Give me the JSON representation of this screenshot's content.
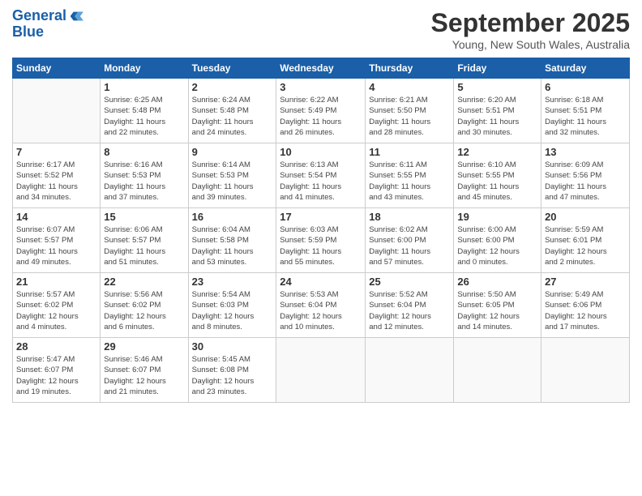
{
  "header": {
    "logo_line1": "General",
    "logo_line2": "Blue",
    "title": "September 2025",
    "subtitle": "Young, New South Wales, Australia"
  },
  "columns": [
    "Sunday",
    "Monday",
    "Tuesday",
    "Wednesday",
    "Thursday",
    "Friday",
    "Saturday"
  ],
  "weeks": [
    [
      {
        "num": "",
        "detail": ""
      },
      {
        "num": "1",
        "detail": "Sunrise: 6:25 AM\nSunset: 5:48 PM\nDaylight: 11 hours\nand 22 minutes."
      },
      {
        "num": "2",
        "detail": "Sunrise: 6:24 AM\nSunset: 5:48 PM\nDaylight: 11 hours\nand 24 minutes."
      },
      {
        "num": "3",
        "detail": "Sunrise: 6:22 AM\nSunset: 5:49 PM\nDaylight: 11 hours\nand 26 minutes."
      },
      {
        "num": "4",
        "detail": "Sunrise: 6:21 AM\nSunset: 5:50 PM\nDaylight: 11 hours\nand 28 minutes."
      },
      {
        "num": "5",
        "detail": "Sunrise: 6:20 AM\nSunset: 5:51 PM\nDaylight: 11 hours\nand 30 minutes."
      },
      {
        "num": "6",
        "detail": "Sunrise: 6:18 AM\nSunset: 5:51 PM\nDaylight: 11 hours\nand 32 minutes."
      }
    ],
    [
      {
        "num": "7",
        "detail": "Sunrise: 6:17 AM\nSunset: 5:52 PM\nDaylight: 11 hours\nand 34 minutes."
      },
      {
        "num": "8",
        "detail": "Sunrise: 6:16 AM\nSunset: 5:53 PM\nDaylight: 11 hours\nand 37 minutes."
      },
      {
        "num": "9",
        "detail": "Sunrise: 6:14 AM\nSunset: 5:53 PM\nDaylight: 11 hours\nand 39 minutes."
      },
      {
        "num": "10",
        "detail": "Sunrise: 6:13 AM\nSunset: 5:54 PM\nDaylight: 11 hours\nand 41 minutes."
      },
      {
        "num": "11",
        "detail": "Sunrise: 6:11 AM\nSunset: 5:55 PM\nDaylight: 11 hours\nand 43 minutes."
      },
      {
        "num": "12",
        "detail": "Sunrise: 6:10 AM\nSunset: 5:55 PM\nDaylight: 11 hours\nand 45 minutes."
      },
      {
        "num": "13",
        "detail": "Sunrise: 6:09 AM\nSunset: 5:56 PM\nDaylight: 11 hours\nand 47 minutes."
      }
    ],
    [
      {
        "num": "14",
        "detail": "Sunrise: 6:07 AM\nSunset: 5:57 PM\nDaylight: 11 hours\nand 49 minutes."
      },
      {
        "num": "15",
        "detail": "Sunrise: 6:06 AM\nSunset: 5:57 PM\nDaylight: 11 hours\nand 51 minutes."
      },
      {
        "num": "16",
        "detail": "Sunrise: 6:04 AM\nSunset: 5:58 PM\nDaylight: 11 hours\nand 53 minutes."
      },
      {
        "num": "17",
        "detail": "Sunrise: 6:03 AM\nSunset: 5:59 PM\nDaylight: 11 hours\nand 55 minutes."
      },
      {
        "num": "18",
        "detail": "Sunrise: 6:02 AM\nSunset: 6:00 PM\nDaylight: 11 hours\nand 57 minutes."
      },
      {
        "num": "19",
        "detail": "Sunrise: 6:00 AM\nSunset: 6:00 PM\nDaylight: 12 hours\nand 0 minutes."
      },
      {
        "num": "20",
        "detail": "Sunrise: 5:59 AM\nSunset: 6:01 PM\nDaylight: 12 hours\nand 2 minutes."
      }
    ],
    [
      {
        "num": "21",
        "detail": "Sunrise: 5:57 AM\nSunset: 6:02 PM\nDaylight: 12 hours\nand 4 minutes."
      },
      {
        "num": "22",
        "detail": "Sunrise: 5:56 AM\nSunset: 6:02 PM\nDaylight: 12 hours\nand 6 minutes."
      },
      {
        "num": "23",
        "detail": "Sunrise: 5:54 AM\nSunset: 6:03 PM\nDaylight: 12 hours\nand 8 minutes."
      },
      {
        "num": "24",
        "detail": "Sunrise: 5:53 AM\nSunset: 6:04 PM\nDaylight: 12 hours\nand 10 minutes."
      },
      {
        "num": "25",
        "detail": "Sunrise: 5:52 AM\nSunset: 6:04 PM\nDaylight: 12 hours\nand 12 minutes."
      },
      {
        "num": "26",
        "detail": "Sunrise: 5:50 AM\nSunset: 6:05 PM\nDaylight: 12 hours\nand 14 minutes."
      },
      {
        "num": "27",
        "detail": "Sunrise: 5:49 AM\nSunset: 6:06 PM\nDaylight: 12 hours\nand 17 minutes."
      }
    ],
    [
      {
        "num": "28",
        "detail": "Sunrise: 5:47 AM\nSunset: 6:07 PM\nDaylight: 12 hours\nand 19 minutes."
      },
      {
        "num": "29",
        "detail": "Sunrise: 5:46 AM\nSunset: 6:07 PM\nDaylight: 12 hours\nand 21 minutes."
      },
      {
        "num": "30",
        "detail": "Sunrise: 5:45 AM\nSunset: 6:08 PM\nDaylight: 12 hours\nand 23 minutes."
      },
      {
        "num": "",
        "detail": ""
      },
      {
        "num": "",
        "detail": ""
      },
      {
        "num": "",
        "detail": ""
      },
      {
        "num": "",
        "detail": ""
      }
    ]
  ]
}
